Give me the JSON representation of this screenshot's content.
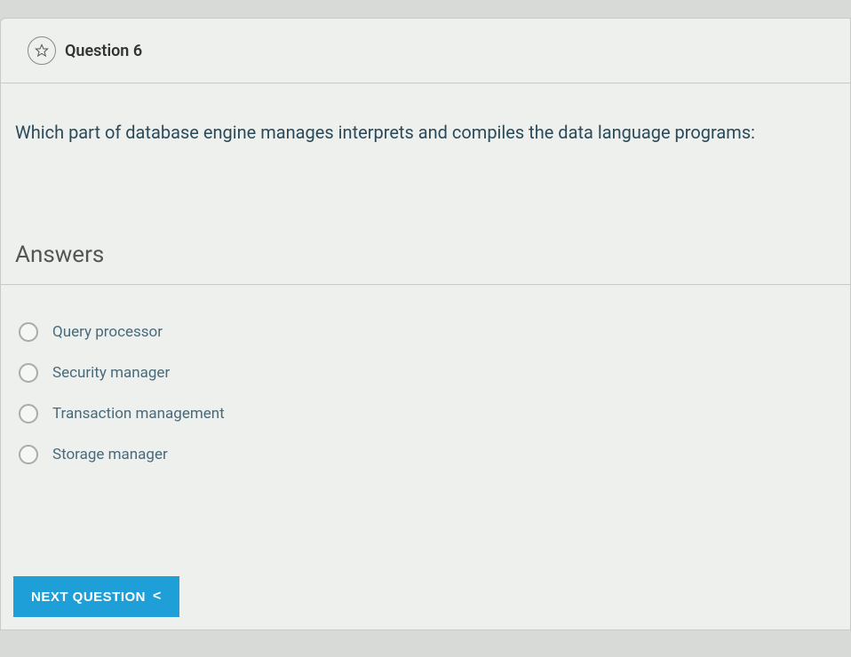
{
  "question": {
    "label": "Question 6",
    "text": "Which part of database engine manages interprets and compiles the data language programs:"
  },
  "answers": {
    "heading": "Answers",
    "options": [
      "Query processor",
      "Security manager",
      "Transaction management",
      "Storage manager"
    ]
  },
  "nextButton": {
    "label": "NEXT QUESTION",
    "chevron": "<"
  }
}
